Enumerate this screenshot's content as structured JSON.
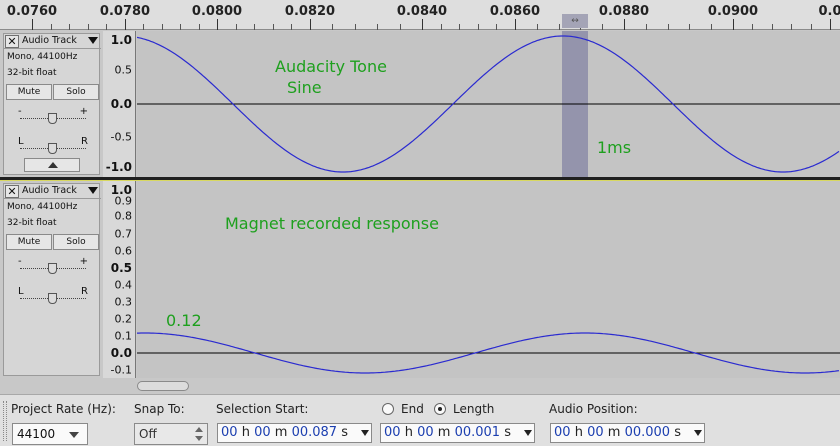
{
  "ruler": {
    "labels": [
      "0.0760",
      "0.0780",
      "0.0800",
      "0.0820",
      "0.0840",
      "0.0860",
      "0.0880",
      "0.0900",
      "0.0"
    ]
  },
  "tracks": [
    {
      "name": "Audio Track",
      "info_line1": "Mono, 44100Hz",
      "info_line2": "32-bit float",
      "mute_label": "Mute",
      "solo_label": "Solo",
      "gain_minus": "-",
      "gain_plus": "+",
      "pan_left": "L",
      "pan_right": "R",
      "vruler_labels": [
        "1.0",
        "0.5",
        "0.0",
        "-0.5",
        "-1.0"
      ],
      "annotation_line1": "Audacity Tone",
      "annotation_line2": "Sine",
      "selection_label": "1ms"
    },
    {
      "name": "Audio Track",
      "info_line1": "Mono, 44100Hz",
      "info_line2": "32-bit float",
      "mute_label": "Mute",
      "solo_label": "Solo",
      "gain_minus": "-",
      "gain_plus": "+",
      "pan_left": "L",
      "pan_right": "R",
      "vruler_labels": [
        "1.0",
        "0.9",
        "0.8",
        "0.7",
        "0.6",
        "0.5",
        "0.4",
        "0.3",
        "0.2",
        "0.1",
        "0.0",
        "-0.1"
      ],
      "annotation_title": "Magnet recorded response",
      "annotation_peak": "0.12"
    }
  ],
  "toolbar": {
    "project_rate_label": "Project Rate (Hz):",
    "project_rate_value": "44100",
    "snap_to_label": "Snap To:",
    "snap_to_value": "Off",
    "selection_start_label": "Selection Start:",
    "end_label": "End",
    "length_label": "Length",
    "audio_position_label": "Audio Position:",
    "selection_start": {
      "h": "00",
      "m": "00",
      "s": "00.087",
      "unit_h": "h",
      "unit_m": "m",
      "unit_s": "s"
    },
    "length": {
      "h": "00",
      "m": "00",
      "s": "00.001",
      "unit_h": "h",
      "unit_m": "m",
      "unit_s": "s"
    },
    "audio_position": {
      "h": "00",
      "m": "00",
      "s": "00.000",
      "unit_h": "h",
      "unit_m": "m",
      "unit_s": "s"
    },
    "length_selected": true
  },
  "colors": {
    "waveform": "#2a2ad0",
    "annotation": "#1ea01e",
    "selection": "#9494ac",
    "time_digits": "#1c3fb0"
  },
  "icons": [
    "close-icon",
    "track-menu-icon",
    "collapse-icon",
    "dropdown-icon",
    "spin-icon",
    "radio-icon"
  ]
}
